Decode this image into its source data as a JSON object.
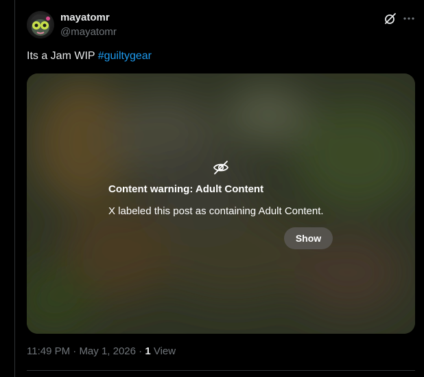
{
  "author": {
    "display_name": "mayatomr",
    "handle": "@mayatomr"
  },
  "tweet": {
    "text": "Its a Jam WIP ",
    "hashtag": "#guiltygear"
  },
  "media": {
    "warning_icon": "eye-off-icon",
    "warning_title": "Content warning: Adult Content",
    "warning_description": "X labeled this post as containing Adult Content.",
    "show_label": "Show"
  },
  "meta": {
    "time": "11:49 PM",
    "separator1": " · ",
    "date": "May 1, 2026",
    "separator2": " · ",
    "views_count": "1",
    "views_label": " View"
  },
  "icons": {
    "grok": "grok-icon",
    "more": "more-icon"
  },
  "colors": {
    "background": "#000000",
    "text_primary": "#e7e9ea",
    "text_secondary": "#71767b",
    "link": "#1d9bf0",
    "border": "#2f3336"
  }
}
